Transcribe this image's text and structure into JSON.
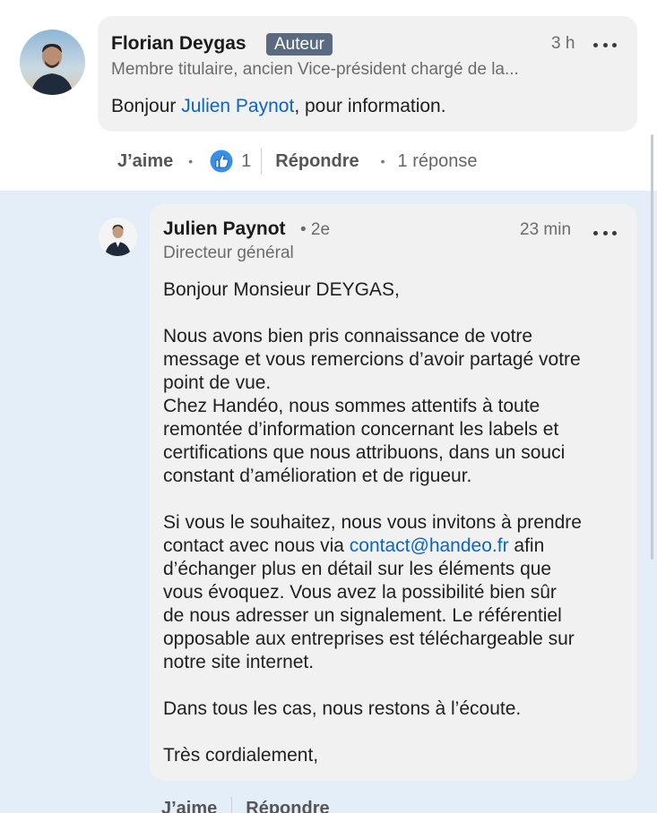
{
  "comment": {
    "author": "Florian Deygas",
    "badge": "Auteur",
    "headline": "Membre titulaire, ancien Vice-président chargé de la...",
    "time": "3 h",
    "text_before": "Bonjour ",
    "mention": "Julien Paynot",
    "text_after": ", pour information.",
    "actions": {
      "like_label": "J’aime",
      "reaction_count": "1",
      "reply_label": "Répondre",
      "replies_count": "1 réponse"
    }
  },
  "reply": {
    "author": "Julien Paynot",
    "degree": "• 2e",
    "headline": "Directeur général",
    "time": "23 min",
    "paragraphs": {
      "greeting": "Bonjour Monsieur DEYGAS,",
      "p1_l1": "Nous avons bien pris connaissance de votre",
      "p1_l2": "message et vous remercions d’avoir partagé votre",
      "p1_l3": "point de vue.",
      "p1_l4": "Chez Handéo, nous sommes attentifs à toute",
      "p1_l5": "remontée d’information concernant les labels et",
      "p1_l6": "certifications que nous attribuons, dans un souci",
      "p1_l7": "constant d’amélioration et de rigueur.",
      "p2_l1": "Si vous le souhaitez, nous vous invitons à prendre",
      "p2_l2_before": "contact avec nous via ",
      "p2_l2_link": "contact@handeo.fr",
      "p2_l2_after": " afin",
      "p2_l3": "d’échanger plus en détail sur les éléments que",
      "p2_l4": "vous évoquez. Vous avez la possibilité bien sûr",
      "p2_l5": "de nous adresser un signalement. Le référentiel",
      "p2_l6": "opposable aux entreprises est téléchargeable sur",
      "p2_l7": "notre site internet.",
      "p3": "Dans tous les cas, nous restons à l’écoute.",
      "closing": "Très cordialement,"
    },
    "actions": {
      "like_label": "J’aime",
      "reply_label": "Répondre"
    }
  },
  "icons": {
    "more": "more-horizontal-icon",
    "like_reaction": "thumbs-up-reaction-icon"
  },
  "colors": {
    "link": "#0a66c2",
    "badge_bg": "#5a6b80",
    "reply_area_bg": "#e4eef9",
    "bubble_bg": "#f1f1f1"
  }
}
